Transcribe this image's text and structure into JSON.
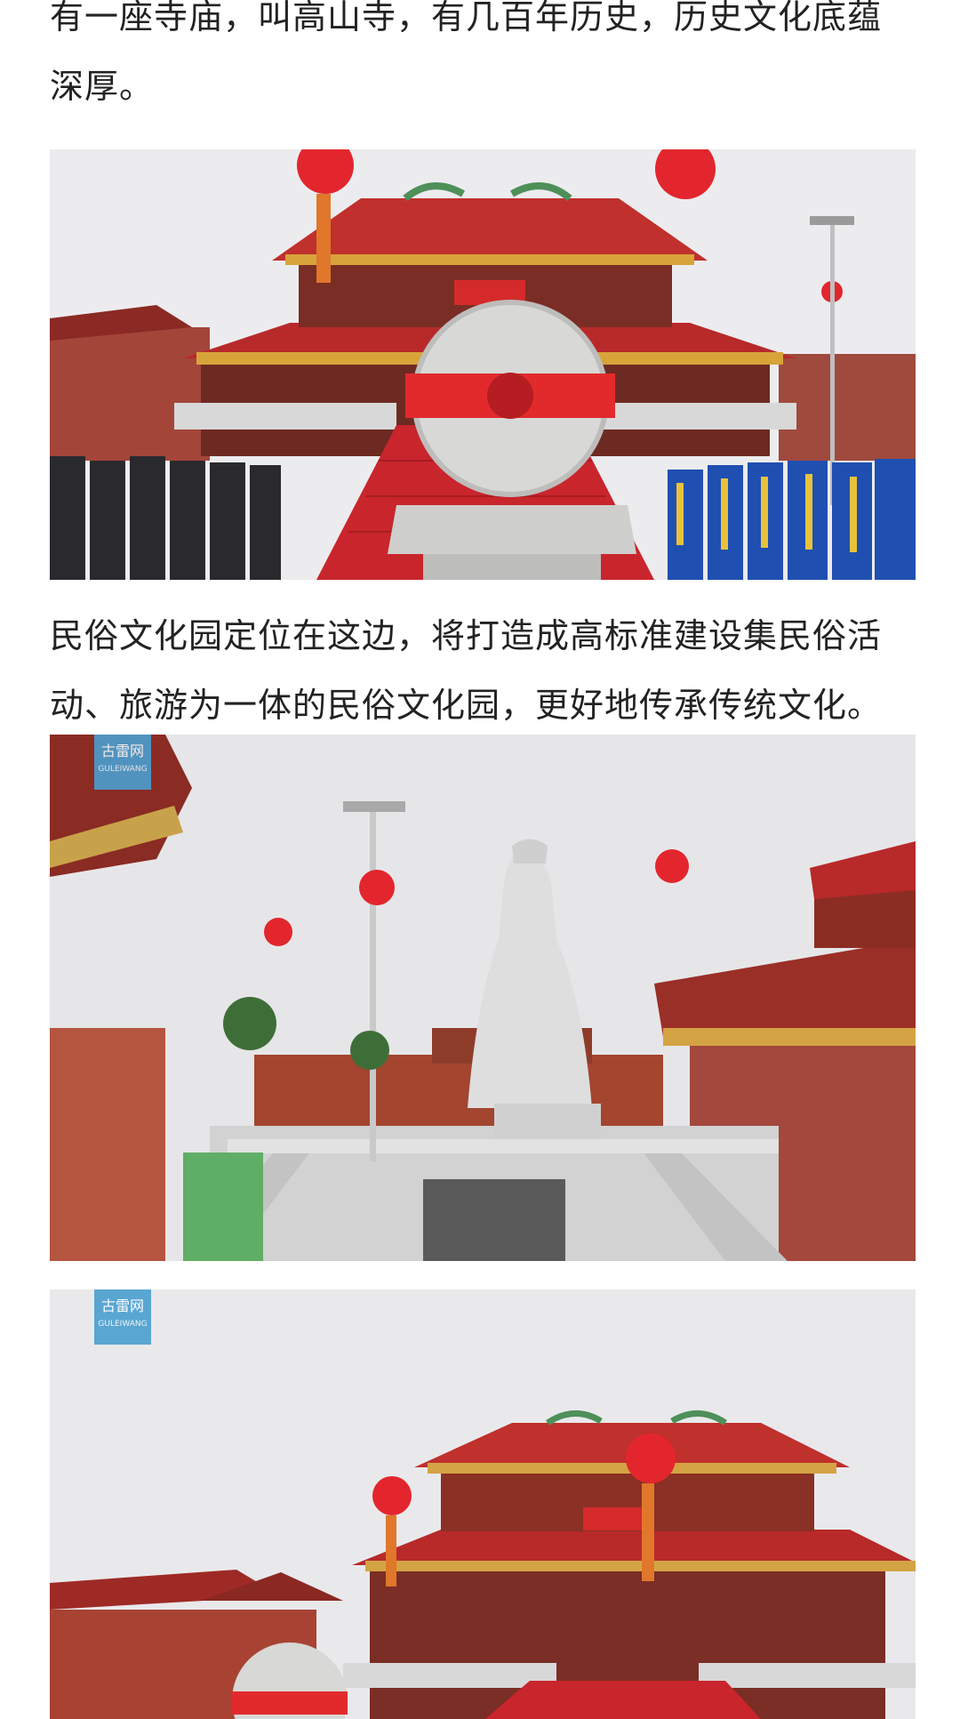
{
  "article": {
    "para1_line1": "有一座寺庙，叫高山寺，有几百年历史，历史文化底蕴",
    "para1_line2": "深厚。",
    "para2_line1": "民俗文化园定位在这边，将打造成高标准建设集民俗活",
    "para2_line2": "动、旅游为一体的民俗文化园，更好地传承传统文化。"
  },
  "images": {
    "fig1": "temple-ceremony-photo",
    "fig2": "goddess-statue-photo",
    "fig3": "temple-exterior-photo"
  },
  "watermark": {
    "label": "古雷网",
    "sub": "GULEIWANG"
  },
  "colors": {
    "text": "#222222",
    "temple_red": "#b8292a",
    "lantern_red": "#e3262d",
    "sky": "#e9e9eb",
    "watermark_blue": "#4a9fd0"
  }
}
